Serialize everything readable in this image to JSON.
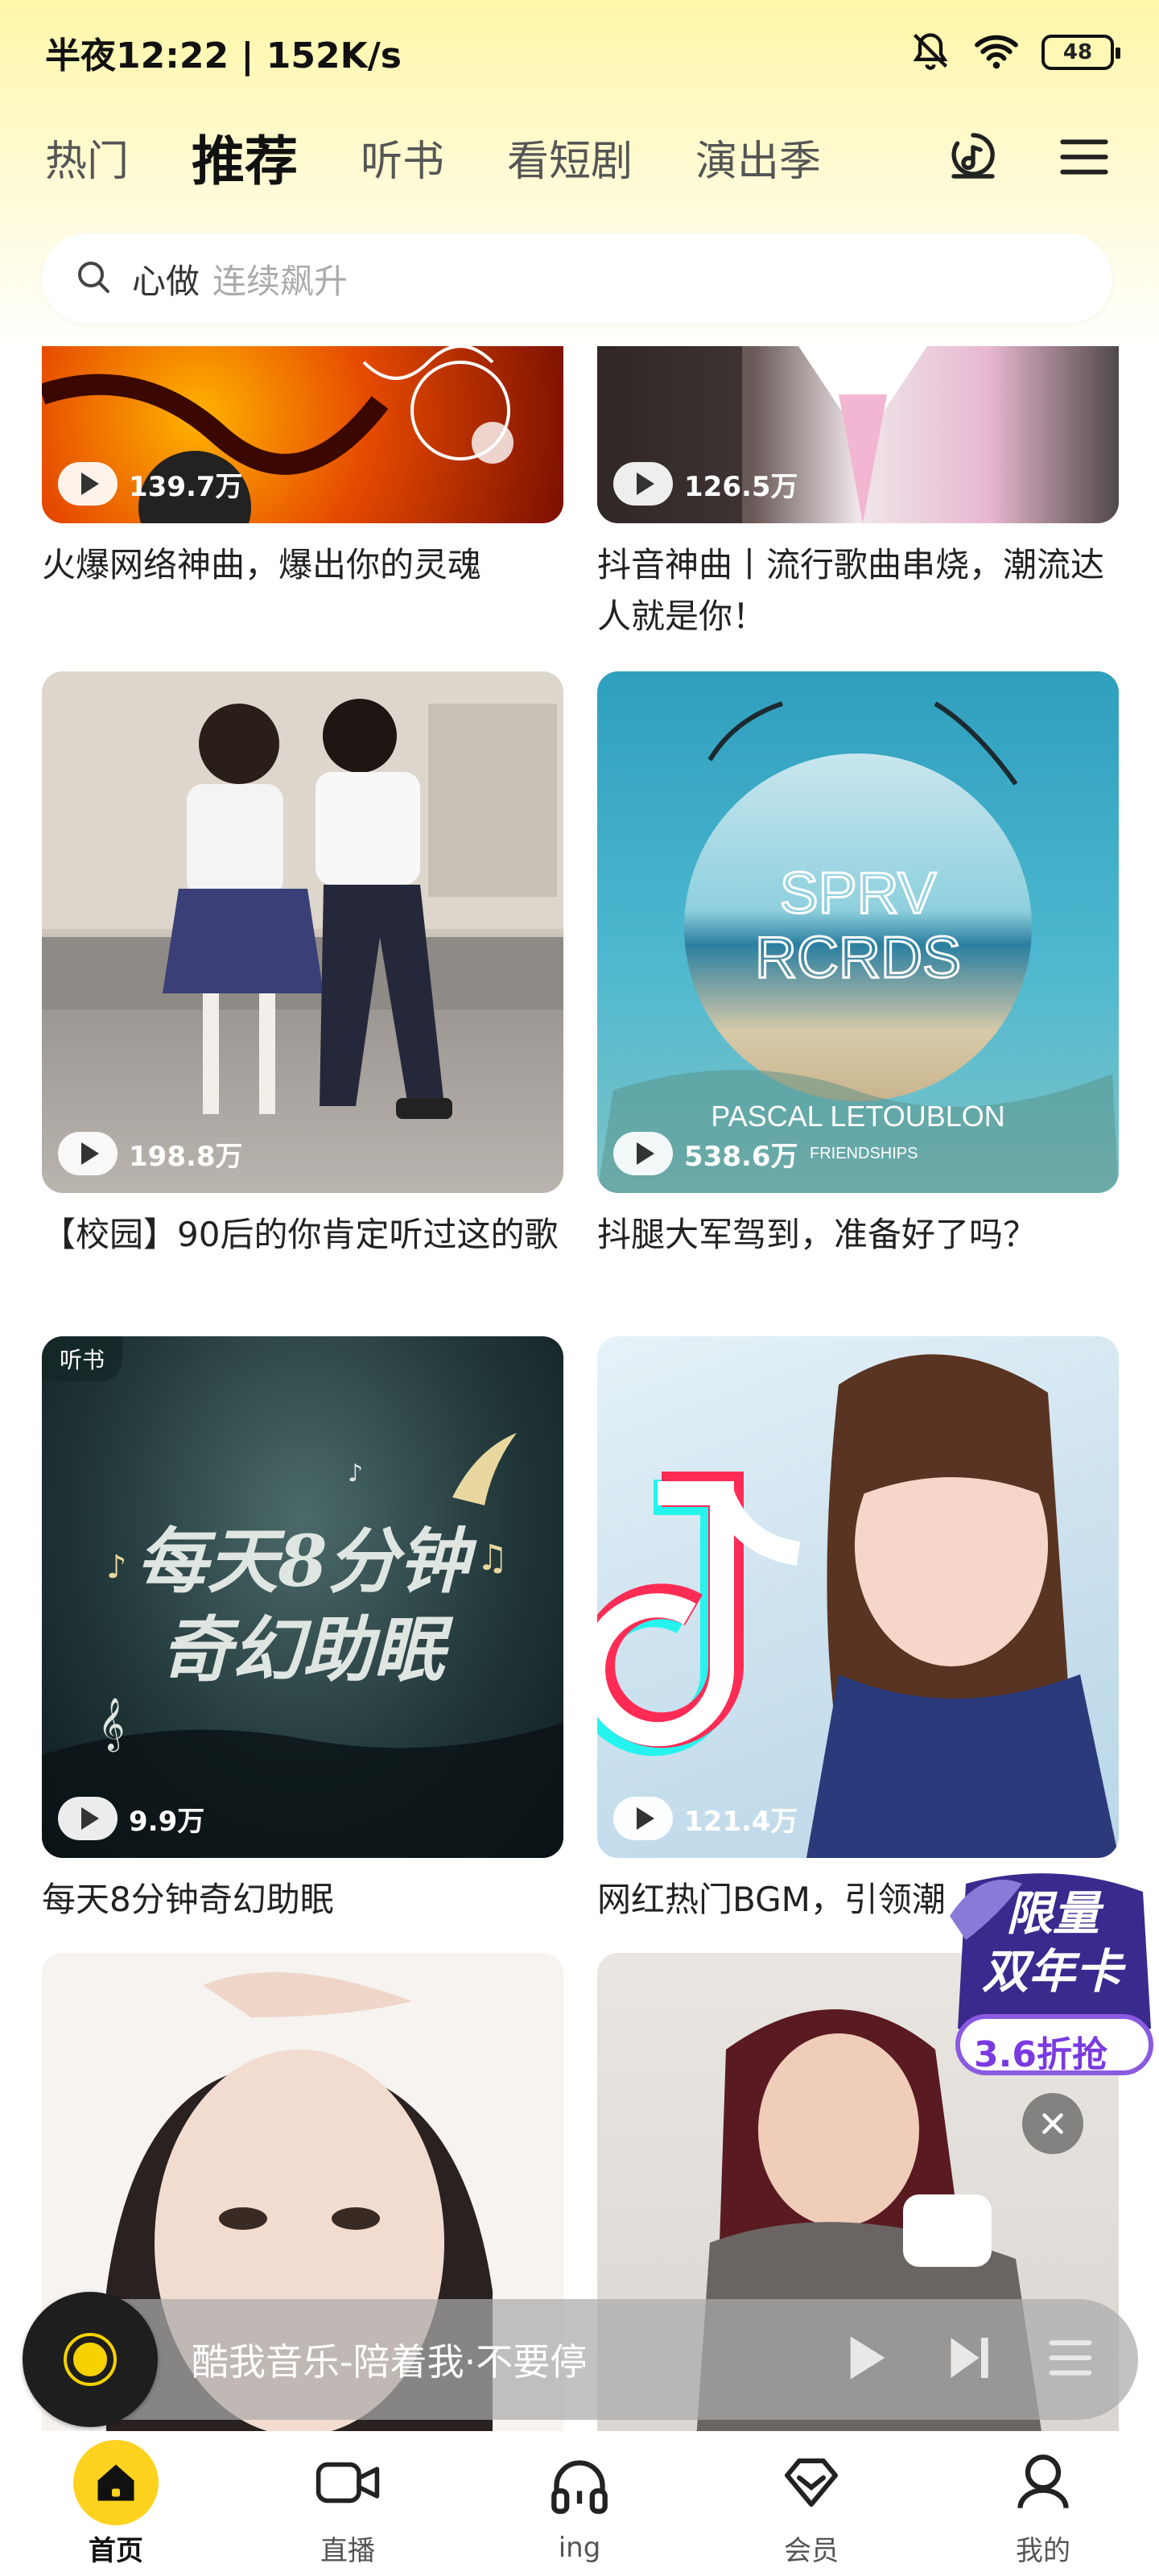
{
  "status_bar": {
    "time": "半夜12:22",
    "speed": "152K/s",
    "battery": "48"
  },
  "top_tabs": [
    "热门",
    "推荐",
    "听书",
    "看短剧",
    "演出季"
  ],
  "active_tab": "推荐",
  "search": {
    "keyword": "心做",
    "hint": "连续飙升"
  },
  "cards": [
    {
      "title": "火爆网络神曲，爆出你的灵魂",
      "plays": "139.7万"
    },
    {
      "title": "抖音神曲丨流行歌曲串烧，潮流达人就是你！",
      "plays": "126.5万"
    },
    {
      "title": "【校园】90后的你肯定听过这的歌",
      "plays": "198.8万"
    },
    {
      "title": "抖腿大军驾到，准备好了吗？",
      "plays": "538.6万"
    },
    {
      "title": "每天8分钟奇幻助眠",
      "plays": "9.9万",
      "badge": "听书"
    },
    {
      "title": "网红热门BGM，引领潮",
      "plays": "121.4万"
    }
  ],
  "cover_art": {
    "album_text_1": "SPRV",
    "album_text_2": "RCRDS",
    "album_artist": "PASCAL LETOUBLON",
    "album_sub": "FRIENDSHIPS",
    "sleep_line_1": "每天8分钟",
    "sleep_line_2": "奇幻助眠"
  },
  "promo": {
    "line1": "限量",
    "line2": "双年卡",
    "line3": "3.6折抢"
  },
  "mini_player": {
    "text": "酷我音乐-陪着我·不要停"
  },
  "bottom_nav": [
    {
      "label": "首页",
      "icon": "home-icon"
    },
    {
      "label": "直播",
      "icon": "video-camera-icon"
    },
    {
      "label": "ing",
      "icon": "headphones-icon"
    },
    {
      "label": "会员",
      "icon": "vip-diamond-icon"
    },
    {
      "label": "我的",
      "icon": "user-icon"
    }
  ],
  "colors": {
    "accent": "#ffd21f",
    "header_top": "#fff6a8"
  }
}
